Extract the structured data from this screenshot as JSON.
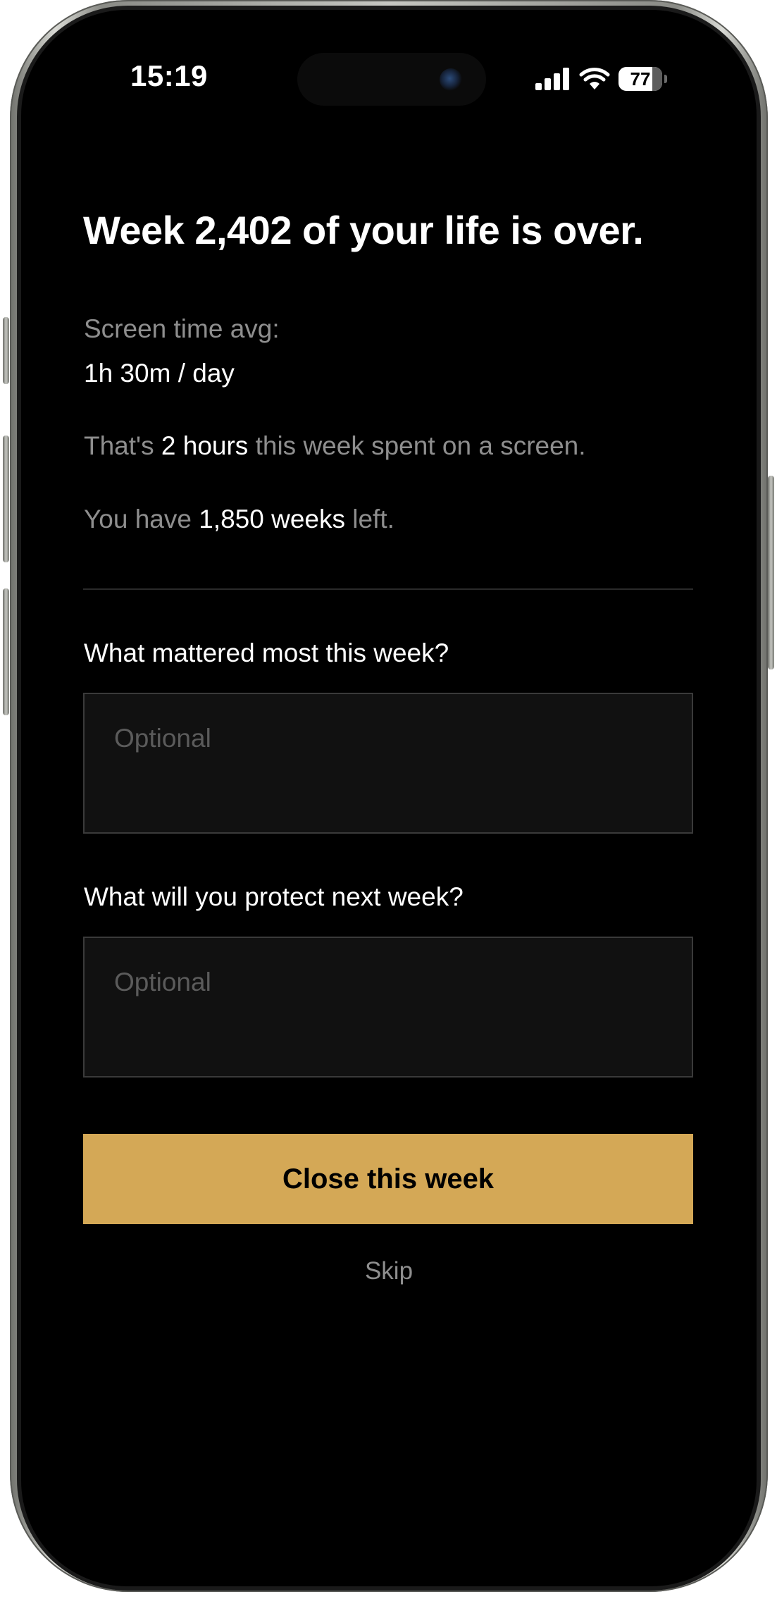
{
  "status_bar": {
    "time": "15:19",
    "battery_percent": "77",
    "battery_level": 0.77,
    "signal_icon": "cellular-signal-icon",
    "wifi_icon": "wifi-icon"
  },
  "reflection": {
    "title": "Week 2,402 of your life is over.",
    "screen_time_label": "Screen time avg:",
    "screen_time_value": "1h 30m / day",
    "weekly_screen": {
      "prefix": "That's ",
      "highlight": "2 hours",
      "suffix": " this week spent on a screen."
    },
    "weeks_left": {
      "prefix": "You have ",
      "highlight": "1,850 weeks",
      "suffix": " left."
    }
  },
  "form": {
    "question_1": "What mattered most this week?",
    "answer_1_placeholder": "Optional",
    "answer_1_value": "",
    "question_2": "What will you protect next week?",
    "answer_2_placeholder": "Optional",
    "answer_2_value": ""
  },
  "actions": {
    "primary_label": "Close this week",
    "skip_label": "Skip"
  },
  "colors": {
    "background": "#000000",
    "accent": "#d4a856",
    "muted_text": "#8e8e8e",
    "input_background": "#111111"
  }
}
